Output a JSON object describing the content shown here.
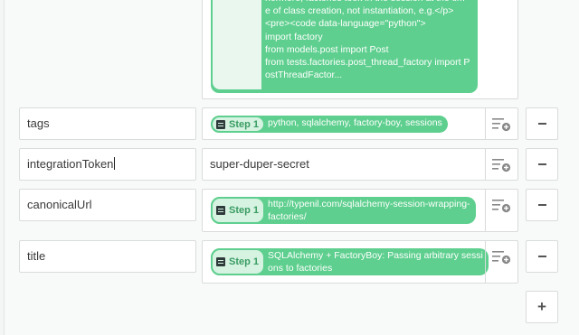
{
  "colors": {
    "accent": "#5ecf8e",
    "step_text": "#3a9c62"
  },
  "code_card": {
    "text": "hermore, factories took in the session at the tim\ne of class creation, not instantiation, e.g.</p>\n<pre><code data-language=\"python\">\nimport factory\nfrom models.post import Post\nfrom tests.factories.post_thread_factory import P\nostThreadFactor..."
  },
  "rows": [
    {
      "key": "tags",
      "step": "Step 1",
      "value": "python, sqlalchemy, factory-boy, sessions"
    },
    {
      "key": "integrationToken",
      "value": "super-duper-secret"
    },
    {
      "key": "canonicalUrl",
      "step": "Step 1",
      "value": "http://typenil.com/sqlalchemy-session-wrapping-\nfactories/"
    },
    {
      "key": "title",
      "step": "Step 1",
      "value": "SQLAlchemy + FactoryBoy: Passing arbitrary sessi\nons to factories"
    }
  ],
  "icons": {
    "add_value": "list-add-icon",
    "remove": "minus-icon",
    "add_row": "plus-icon",
    "step": "step-list-icon"
  },
  "add_row_label": "+"
}
